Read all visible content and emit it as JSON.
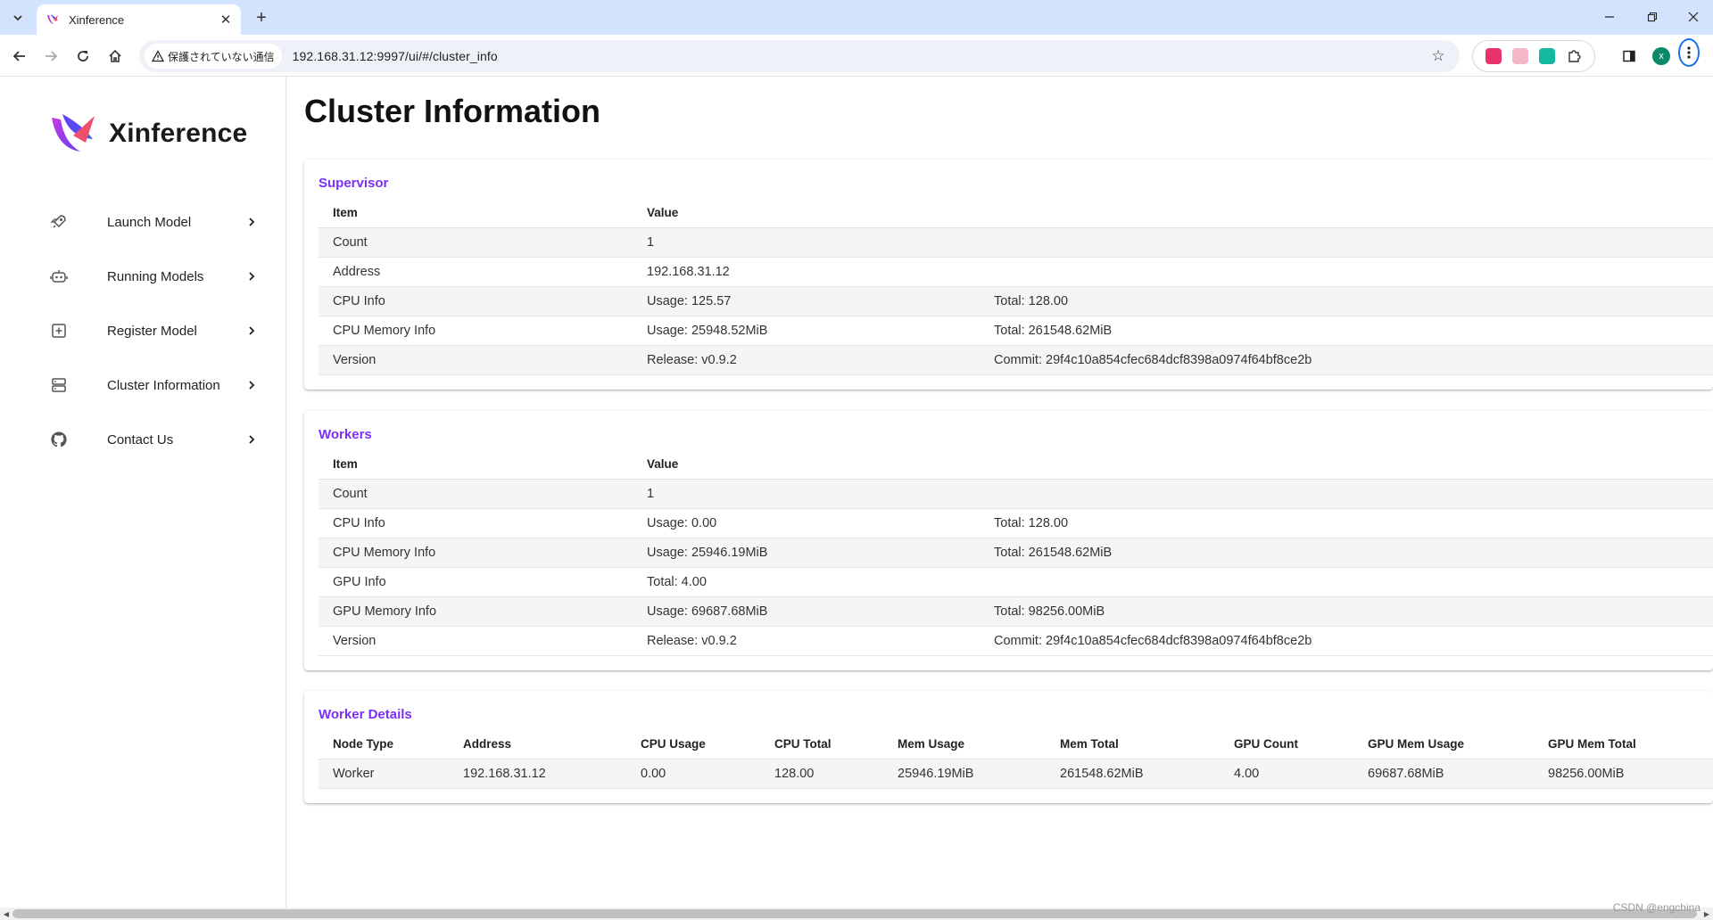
{
  "browser": {
    "tab_title": "Xinference",
    "security_label": "保護されていない通信",
    "url": "192.168.31.12:9997/ui/#/cluster_info",
    "profile_initial": "x"
  },
  "sidebar": {
    "brand": "Xinference",
    "items": [
      {
        "label": "Launch Model",
        "icon": "rocket-icon"
      },
      {
        "label": "Running Models",
        "icon": "robot-icon"
      },
      {
        "label": "Register Model",
        "icon": "plus-square-icon"
      },
      {
        "label": "Cluster Information",
        "icon": "server-icon"
      },
      {
        "label": "Contact Us",
        "icon": "github-icon"
      }
    ]
  },
  "page": {
    "title": "Cluster Information"
  },
  "supervisor": {
    "title": "Supervisor",
    "headers": [
      "Item",
      "Value",
      ""
    ],
    "rows": [
      [
        "Count",
        "1",
        ""
      ],
      [
        "Address",
        "192.168.31.12",
        ""
      ],
      [
        "CPU Info",
        "Usage: 125.57",
        "Total: 128.00"
      ],
      [
        "CPU Memory Info",
        "Usage: 25948.52MiB",
        "Total: 261548.62MiB"
      ],
      [
        "Version",
        "Release: v0.9.2",
        "Commit: 29f4c10a854cfec684dcf8398a0974f64bf8ce2b"
      ]
    ]
  },
  "workers": {
    "title": "Workers",
    "headers": [
      "Item",
      "Value",
      ""
    ],
    "rows": [
      [
        "Count",
        "1",
        ""
      ],
      [
        "CPU Info",
        "Usage: 0.00",
        "Total: 128.00"
      ],
      [
        "CPU Memory Info",
        "Usage: 25946.19MiB",
        "Total: 261548.62MiB"
      ],
      [
        "GPU Info",
        "Total: 4.00",
        ""
      ],
      [
        "GPU Memory Info",
        "Usage: 69687.68MiB",
        "Total: 98256.00MiB"
      ],
      [
        "Version",
        "Release: v0.9.2",
        "Commit: 29f4c10a854cfec684dcf8398a0974f64bf8ce2b"
      ]
    ]
  },
  "worker_details": {
    "title": "Worker Details",
    "headers": [
      "Node Type",
      "Address",
      "CPU Usage",
      "CPU Total",
      "Mem Usage",
      "Mem Total",
      "GPU Count",
      "GPU Mem Usage",
      "GPU Mem Total"
    ],
    "rows": [
      [
        "Worker",
        "192.168.31.12",
        "0.00",
        "128.00",
        "25946.19MiB",
        "261548.62MiB",
        "4.00",
        "69687.68MiB",
        "98256.00MiB"
      ]
    ]
  },
  "watermark": "CSDN @engchina",
  "colors": {
    "accent": "#7b2ff7",
    "tabbar": "#d3e3fd",
    "row_alt": "#f5f5f5"
  }
}
